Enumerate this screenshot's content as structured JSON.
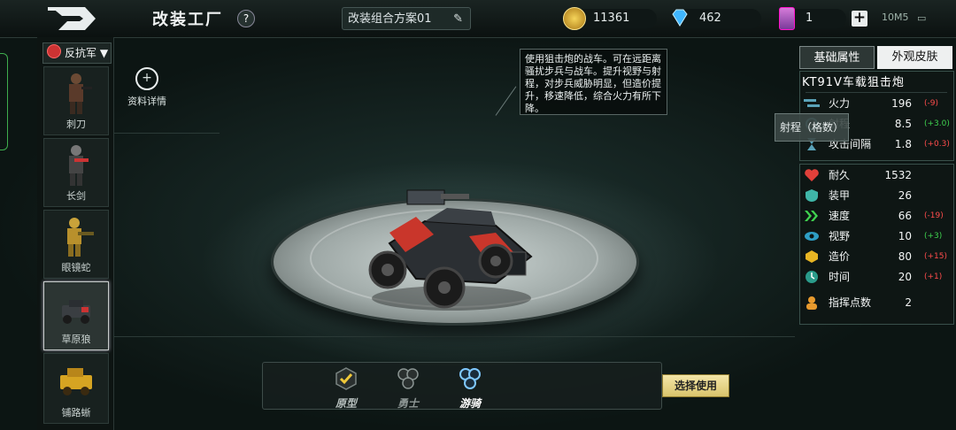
{
  "header": {
    "title": "改装工厂",
    "help": "?",
    "scheme": "改装组合方案01",
    "gold": "11361",
    "diamond": "462",
    "cards": "1",
    "network": "10M5",
    "plus": "+"
  },
  "sidebar": {
    "faction": "反抗军",
    "faction_caret": "▼",
    "units": [
      {
        "name": "刺刀"
      },
      {
        "name": "长剑"
      },
      {
        "name": "眼镜蛇"
      },
      {
        "name": "草原狼"
      },
      {
        "name": "铺路蜥"
      }
    ]
  },
  "info_button": "资料详情",
  "description": "使用狙击炮的战车。可在远距离骚扰步兵与战车。提升视野与射程，对步兵威胁明显，但造价提升，移速降低，综合火力有所下降。",
  "tabs": {
    "active": "基础属性",
    "other": "外观皮肤"
  },
  "vehicle_name": "KT91V车载狙击炮",
  "attack_stats": [
    {
      "label": "火力",
      "value": "196",
      "bonus": "(-9)",
      "color": "red",
      "icon": "crosshair-icon"
    },
    {
      "label": "射程",
      "value": "8.5",
      "bonus": "(+3.0)",
      "color": "green",
      "icon": "range-icon"
    },
    {
      "label": "攻击间隔",
      "value": "1.8",
      "bonus": "(+0.3)",
      "color": "red",
      "icon": "hourglass-icon"
    }
  ],
  "tooltip": "射程（格数）",
  "defense_stats": [
    {
      "label": "耐久",
      "value": "1532",
      "bonus": "",
      "color": "",
      "icon": "heart-icon"
    },
    {
      "label": "装甲",
      "value": "26",
      "bonus": "",
      "color": "",
      "icon": "shield-icon"
    },
    {
      "label": "速度",
      "value": "66",
      "bonus": "(-19)",
      "color": "red",
      "icon": "speed-icon"
    },
    {
      "label": "视野",
      "value": "10",
      "bonus": "(+3)",
      "color": "green",
      "icon": "eye-icon"
    },
    {
      "label": "造价",
      "value": "80",
      "bonus": "(+15)",
      "color": "red",
      "icon": "cost-icon"
    },
    {
      "label": "时间",
      "value": "20",
      "bonus": "(+1)",
      "color": "red",
      "icon": "clock-icon"
    },
    {
      "label": "指挥点数",
      "value": "2",
      "bonus": "",
      "color": "",
      "icon": "commander-icon"
    }
  ],
  "modes": [
    {
      "label": "原型",
      "state": "completed"
    },
    {
      "label": "勇士",
      "state": "locked"
    },
    {
      "label": "游骑",
      "state": "active"
    }
  ],
  "select_button": "选择使用"
}
